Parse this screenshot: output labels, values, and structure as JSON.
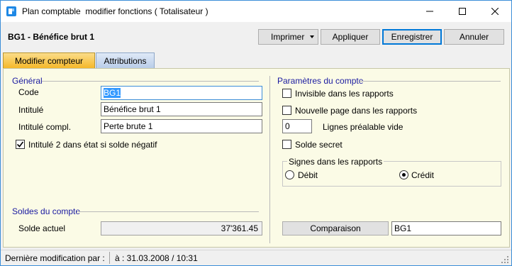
{
  "window": {
    "title": "Plan comptable  modifier fonctions ( Totalisateur )"
  },
  "header": {
    "record_title": "BG1 - Bénéfice brut 1",
    "buttons": {
      "print": "Imprimer",
      "apply": "Appliquer",
      "save": "Enregistrer",
      "cancel": "Annuler"
    }
  },
  "tabs": [
    {
      "label": "Modifier compteur",
      "active": true
    },
    {
      "label": "Attributions",
      "active": false
    }
  ],
  "general": {
    "title": "Général",
    "code_label": "Code",
    "code_value": "BG1",
    "intitule_label": "Intitulé",
    "intitule_value": "Bénéfice brut 1",
    "intitule_compl_label": "Intitulé compl.",
    "intitule_compl_value": "Perte brute 1",
    "intitule2_checkbox_label": "Intitulé 2 dans état si solde négatif",
    "intitule2_checked": true
  },
  "balances": {
    "title": "Soldes du compte",
    "current_balance_label": "Solde actuel",
    "current_balance_value": "37'361.45"
  },
  "account_params": {
    "title": "Paramètres du compte",
    "invisible_label": "Invisible dans les rapports",
    "invisible_checked": false,
    "new_page_label": "Nouvelle page dans les rapports",
    "new_page_checked": false,
    "preceding_lines_value": "0",
    "preceding_lines_label": "Lignes préalable vide",
    "secret_balance_label": "Solde secret",
    "secret_balance_checked": false,
    "signs_title": "Signes dans les rapports",
    "debit_label": "Débit",
    "credit_label": "Crédit",
    "selected_sign": "Crédit",
    "comparison_button": "Comparaison",
    "comparison_value": "BG1"
  },
  "status": {
    "last_modified_label": "Dernière modification par :",
    "at_text": "à : 31.03.2008 / 10:31"
  },
  "colors": {
    "accent": "#0078d7",
    "active_tab": "#f5b82a",
    "panel_bg": "#fbfbe6",
    "group_title": "#1a1aa0"
  }
}
